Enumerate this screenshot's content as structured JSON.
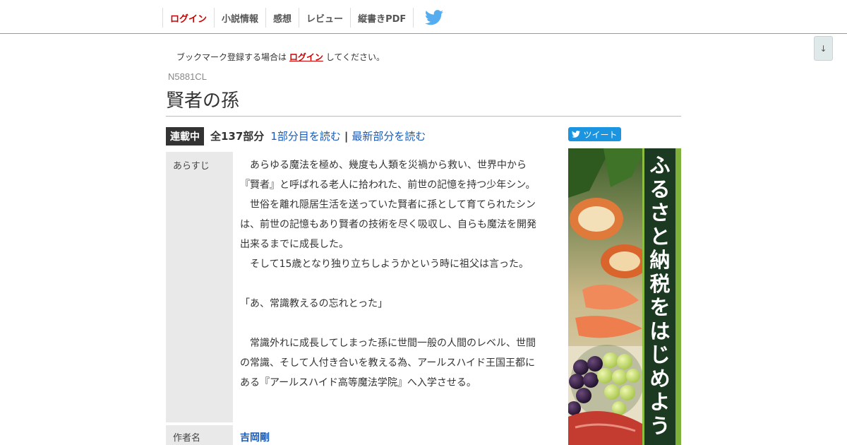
{
  "nav": {
    "login": "ログイン",
    "novel_info": "小説情報",
    "impressions": "感想",
    "review": "レビュー",
    "vertical_pdf": "縦書きPDF",
    "twitter_icon": "twitter-bird-icon"
  },
  "scroll_button": "↓",
  "bookmark": {
    "prefix": "ブックマーク登録する場合は",
    "link": "ログイン",
    "suffix": "してください。"
  },
  "novel": {
    "ncode": "N5881CL",
    "title": "賢者の孫",
    "status": "連載中",
    "total": "全137部分",
    "read_first": "1部分目を読む",
    "separator": "|",
    "read_latest": "最新部分を読む"
  },
  "details": {
    "synopsis_label": "あらすじ",
    "synopsis": [
      "　あらゆる魔法を極め、幾度も人類を災禍から救い、世界中から",
      "『賢者』と呼ばれる老人に拾われた、前世の記憶を持つ少年シン。",
      "　世俗を離れ隠居生活を送っていた賢者に孫として育てられたシン",
      "は、前世の記憶もあり賢者の技術を尽く吸収し、自らも魔法を開発",
      "出来るまでに成長した。",
      "　そして15歳となり独り立ちしようかという時に祖父は言った。",
      "",
      "「あ、常識教えるの忘れとった」",
      "",
      "　常識外れに成長してしまった孫に世間一般の人間のレベル、世間",
      "の常識、そして人付き合いを教える為、アールスハイド王国王都に",
      "ある『アールスハイド高等魔法学院』へ入学させる。"
    ],
    "author_label": "作者名",
    "author": "吉岡剛"
  },
  "sidebar": {
    "tweet_label": "ツイート",
    "ad_text": [
      "ふ",
      "る",
      "さ",
      "と",
      "納",
      "税",
      "を",
      "は",
      "じ",
      "め",
      "よ",
      "う"
    ],
    "colors": {
      "tweet": "#1b95e0",
      "ad_panel": "#1c3a22",
      "ad_frame": "#8bbd3e"
    }
  }
}
